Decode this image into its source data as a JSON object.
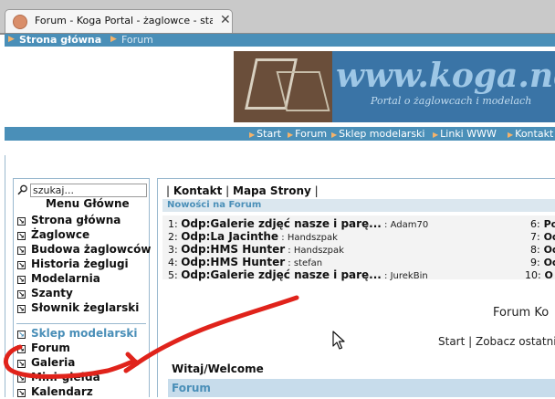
{
  "browser": {
    "tab_title": "Forum - Koga Portal - żaglowce - statki...",
    "tab_close": "✕"
  },
  "breadcrumb": {
    "home": "Strona główna",
    "current": "Forum"
  },
  "banner": {
    "title": "www.koga.net",
    "subtitle": "Portal o żaglowcach i modelach"
  },
  "topnav": {
    "items": [
      "Start",
      "Forum",
      "Sklep modelarski",
      "Linki WWW",
      "Kontakt"
    ]
  },
  "sidebar": {
    "search_value": "szukaj...",
    "menu_title": "Menu Główne",
    "items": [
      {
        "label": "Strona główna"
      },
      {
        "label": "Żaglowce"
      },
      {
        "label": "Budowa żaglowców"
      },
      {
        "label": "Historia żeglugi"
      },
      {
        "label": "Modelarnia"
      },
      {
        "label": "Szanty"
      },
      {
        "label": "Słownik żeglarski"
      },
      {
        "label": "Sklep modelarski"
      },
      {
        "label": "Forum"
      },
      {
        "label": "Galeria"
      },
      {
        "label": "Mini-giełda"
      },
      {
        "label": "Kalendarz"
      }
    ]
  },
  "content": {
    "sep_left": "|",
    "contact": "Kontakt",
    "sep_mid": "|",
    "sitemap": "Mapa Strony",
    "sep_right": "|",
    "news_header": "Nowości na Forum",
    "news": [
      {
        "num": "1:",
        "title": "Odp:Galerie zdjęć nasze i parę...",
        "sep": " : ",
        "author": "Adam70"
      },
      {
        "num": "2:",
        "title": "Odp:La Jacinthe",
        "sep": " : ",
        "author": "Handszpak"
      },
      {
        "num": "3:",
        "title": "Odp:HMS Hunter",
        "sep": " : ",
        "author": "Handszpak"
      },
      {
        "num": "4:",
        "title": "Odp:HMS Hunter",
        "sep": " : ",
        "author": "stefan"
      },
      {
        "num": "5:",
        "title": "Odp:Galerie zdjęć nasze i parę...",
        "sep": " : ",
        "author": "JurekBin"
      }
    ],
    "news_right": [
      {
        "num": "6:",
        "title": "Po"
      },
      {
        "num": "7:",
        "title": "Od"
      },
      {
        "num": "8:",
        "title": "Od"
      },
      {
        "num": "9:",
        "title": "Od"
      },
      {
        "num": "10:",
        "title": "O"
      }
    ],
    "forum_title": "Forum Ko",
    "start_line": "Start | Zobacz ostatnie",
    "welcome": "Witaj/Welcome",
    "forum_bar": "Forum"
  },
  "colors": {
    "accent": "#4a8fb8",
    "arrow": "#f4b36a",
    "annotation": "#e0231b"
  }
}
